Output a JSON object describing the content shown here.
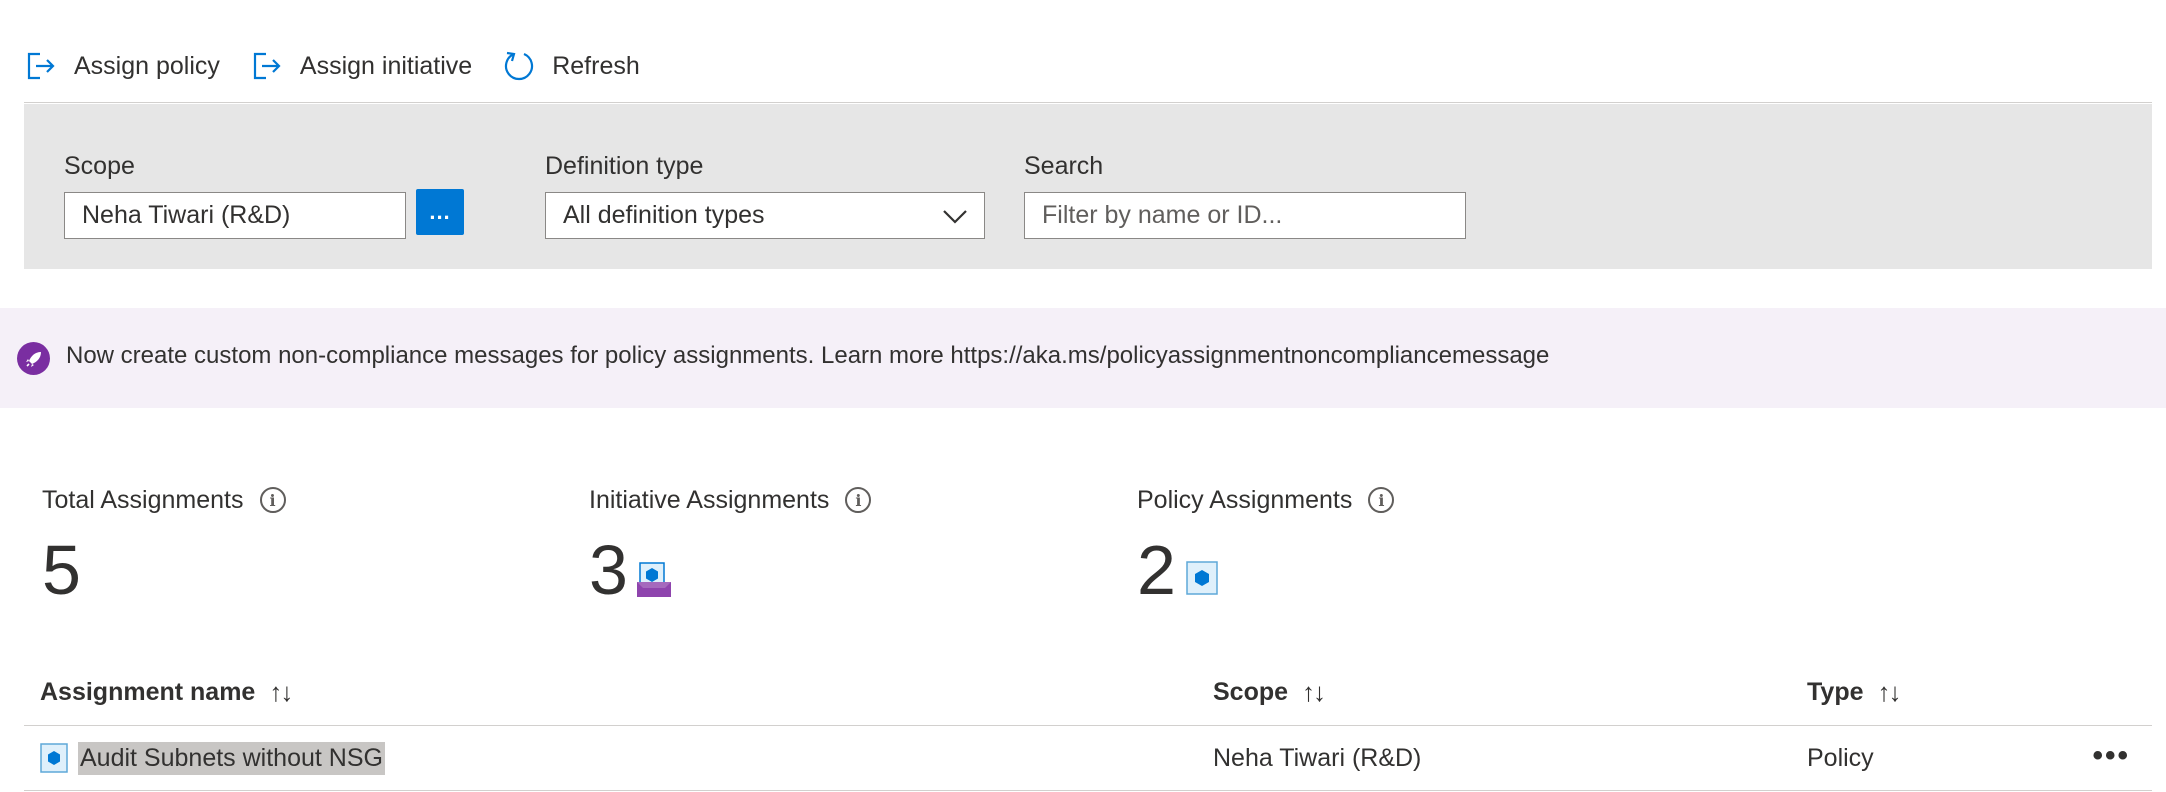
{
  "toolbar": {
    "assign_policy": {
      "label": "Assign policy",
      "icon": "assign-policy-icon"
    },
    "assign_initiative": {
      "label": "Assign initiative",
      "icon": "assign-initiative-icon"
    },
    "refresh": {
      "label": "Refresh",
      "icon": "refresh-icon"
    }
  },
  "filters": {
    "scope_label": "Scope",
    "scope_value": "Neha Tiwari (R&D)",
    "scope_button": "...",
    "definition_type_label": "Definition type",
    "definition_type_value": "All definition types",
    "search_label": "Search",
    "search_placeholder": "Filter by name or ID..."
  },
  "banner": {
    "icon": "rocket-icon",
    "text": "Now create custom non-compliance messages for policy assignments. Learn more https://aka.ms/policyassignmentnoncompliancemessage"
  },
  "stats": [
    {
      "title": "Total Assignments",
      "value": "5"
    },
    {
      "title": "Initiative Assignments",
      "value": "3",
      "icon": "initiative-icon"
    },
    {
      "title": "Policy Assignments",
      "value": "2",
      "icon": "policy-icon"
    }
  ],
  "table": {
    "columns": [
      "Assignment name",
      "Scope",
      "Type"
    ],
    "rows": [
      {
        "name": "Audit Subnets without NSG",
        "scope": "Neha Tiwari (R&D)",
        "type": "Policy",
        "icon": "policy-icon"
      }
    ]
  },
  "colors": {
    "accent": "#0078d4",
    "banner_bg": "#f5f0f8",
    "banner_icon": "#7a2ea1",
    "filter_bg": "#e6e6e6"
  }
}
